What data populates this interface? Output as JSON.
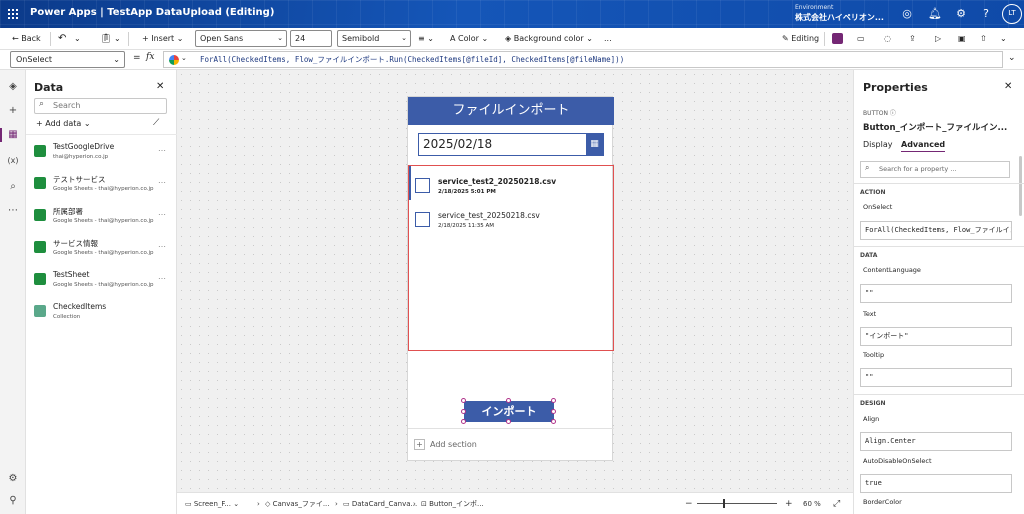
{
  "titlebar": {
    "app_title": "Power Apps  |  TestApp DataUpload (Editing)",
    "env_label": "Environment",
    "env_name": "株式会社ハイペリオン...",
    "avatar": "LT"
  },
  "toolbar": {
    "back": "Back",
    "insert": "Insert",
    "font": "Open Sans",
    "font_size": "24",
    "font_weight": "Semibold",
    "color": "Color",
    "background_color": "Background color",
    "more": "...",
    "editing": "Editing"
  },
  "formula": {
    "property": "OnSelect",
    "fx": "fx",
    "expression": "ForAll(CheckedItems, Flow_ファイルインポート.Run(CheckedItems[@fileId], CheckedItems[@fileName]))"
  },
  "data_panel": {
    "title": "Data",
    "search_placeholder": "Search",
    "add_data": "Add data",
    "items": [
      {
        "name": "TestGoogleDrive",
        "sub": "thai@hyperion.co.jp",
        "color": "#1e8e3e"
      },
      {
        "name": "テストサービス",
        "sub": "Google Sheets - thai@hyperion.co.jp",
        "color": "#1e8e3e"
      },
      {
        "name": "所属部署",
        "sub": "Google Sheets - thai@hyperion.co.jp",
        "color": "#1e8e3e"
      },
      {
        "name": "サービス情報",
        "sub": "Google Sheets - thai@hyperion.co.jp",
        "color": "#1e8e3e"
      },
      {
        "name": "TestSheet",
        "sub": "Google Sheets - thai@hyperion.co.jp",
        "color": "#1e8e3e"
      },
      {
        "name": "CheckedItems",
        "sub": "Collection",
        "color": "#5aa88a"
      }
    ]
  },
  "app_screen": {
    "header": "ファイルインポート",
    "date": "2025/02/18",
    "files": [
      {
        "name": "service_test2_20250218.csv",
        "date": "2/18/2025 5:01 PM"
      },
      {
        "name": "service_test_20250218.csv",
        "date": "2/18/2025 11:35 AM"
      }
    ],
    "import_button": "インポート",
    "add_section": "Add section"
  },
  "statusbar": {
    "crumbs": [
      "Screen_F...",
      "Canvas_ファイ...",
      "DataCard_Canva...",
      "Button_インポ..."
    ],
    "zoom": "60",
    "zoom_unit": "%"
  },
  "properties": {
    "title": "Properties",
    "type": "BUTTON",
    "control_name": "Button_インポート_ファイルイン...",
    "tab_display": "Display",
    "tab_advanced": "Advanced",
    "search_placeholder": "Search for a property ...",
    "sections": {
      "action": "ACTION",
      "data": "DATA",
      "design": "DESIGN"
    },
    "fields": [
      {
        "label": "OnSelect",
        "value": "ForAll(CheckedItems, Flow_ファイルイン..."
      },
      {
        "label": "ContentLanguage",
        "value": "\"\""
      },
      {
        "label": "Text",
        "value": "\"インポート\""
      },
      {
        "label": "Tooltip",
        "value": "\"\""
      },
      {
        "label": "Align",
        "value": "Align.Center"
      },
      {
        "label": "AutoDisableOnSelect",
        "value": "true"
      },
      {
        "label": "BorderColor",
        "value": ""
      }
    ]
  },
  "colors": {
    "brand": "#3c5ca8",
    "accent": "#742774",
    "selection": "#e05050"
  }
}
